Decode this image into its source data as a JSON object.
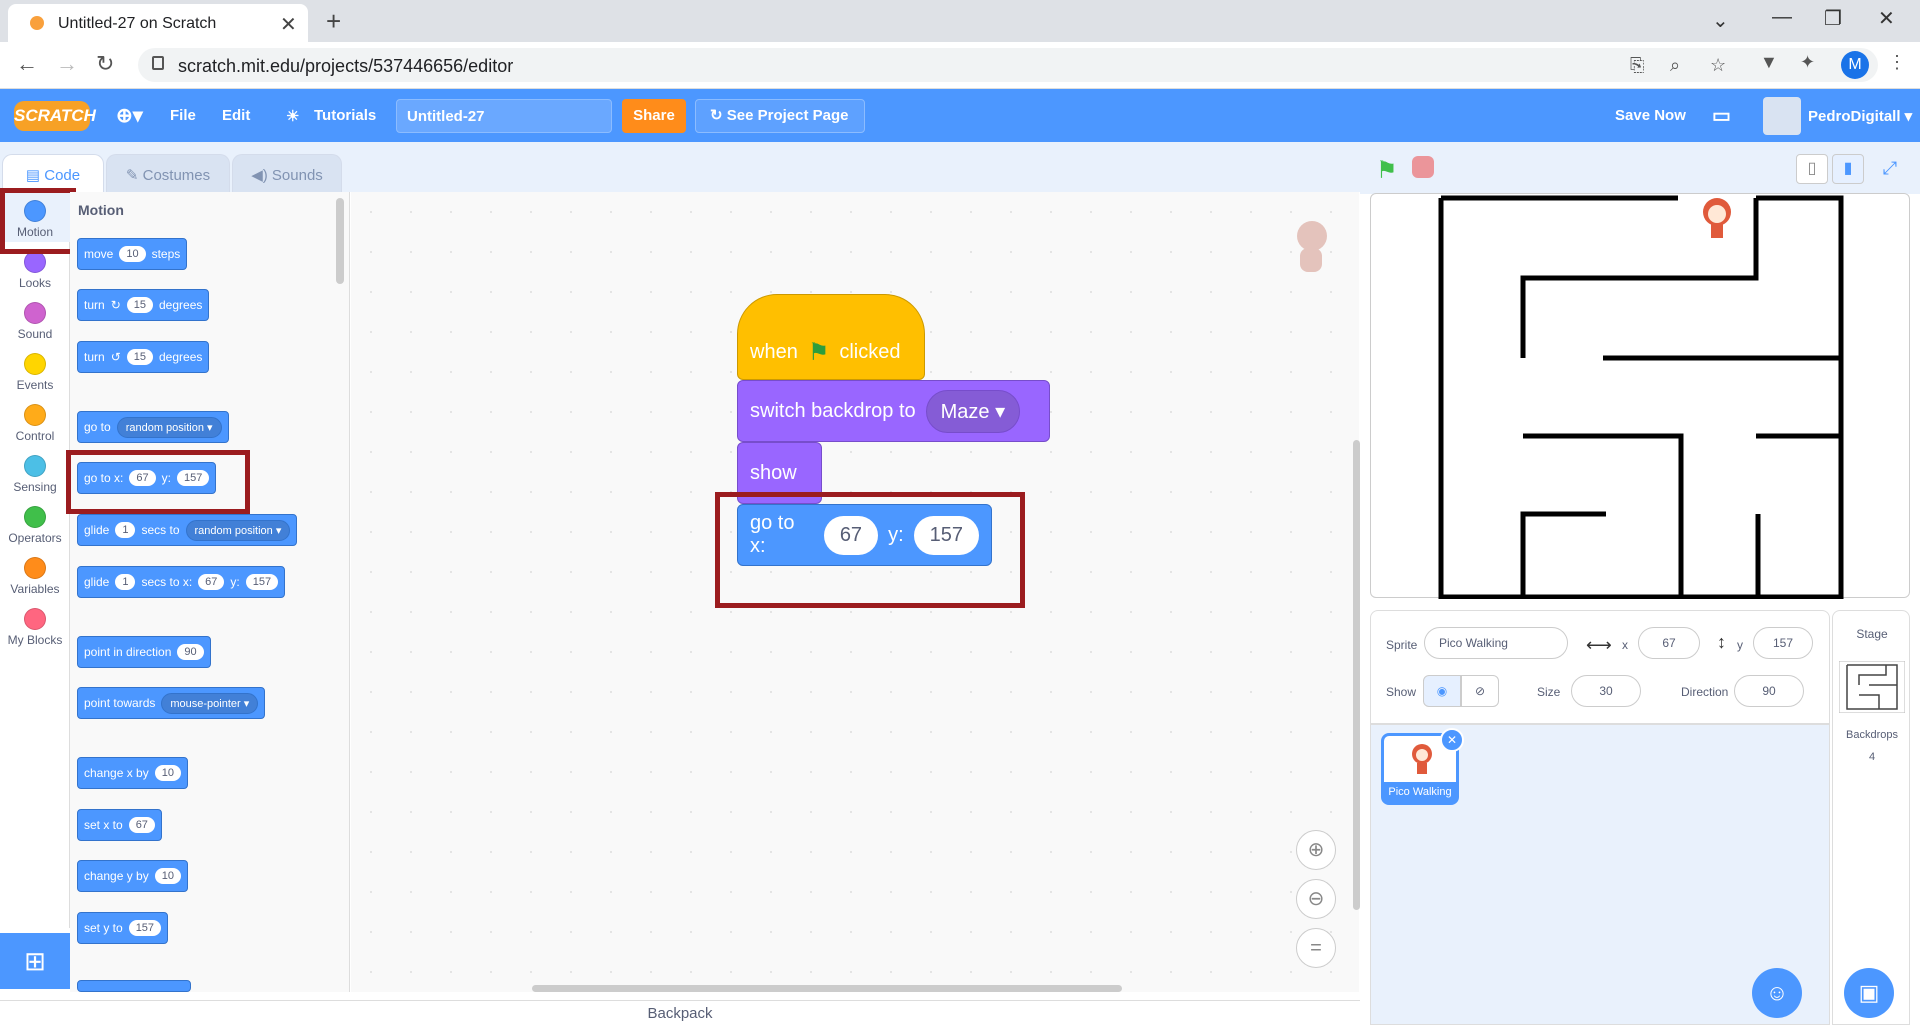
{
  "browser": {
    "tab_title": "Untitled-27 on Scratch",
    "url": "scratch.mit.edu/projects/537446656/editor",
    "profile_initial": "M"
  },
  "menu": {
    "logo": "SCRATCH",
    "file": "File",
    "edit": "Edit",
    "tutorials": "Tutorials",
    "project_name": "Untitled-27",
    "share": "Share",
    "see_project": "See Project Page",
    "save_now": "Save Now",
    "username": "PedroDigitall"
  },
  "tabs": {
    "code": "Code",
    "costumes": "Costumes",
    "sounds": "Sounds"
  },
  "categories": [
    {
      "label": "Motion",
      "color": "#4c97ff"
    },
    {
      "label": "Looks",
      "color": "#9966ff"
    },
    {
      "label": "Sound",
      "color": "#cf63cf"
    },
    {
      "label": "Events",
      "color": "#ffd500"
    },
    {
      "label": "Control",
      "color": "#ffab19"
    },
    {
      "label": "Sensing",
      "color": "#4cbfe6"
    },
    {
      "label": "Operators",
      "color": "#40bf4a"
    },
    {
      "label": "Variables",
      "color": "#ff8c1a"
    },
    {
      "label": "My Blocks",
      "color": "#ff6680"
    }
  ],
  "palette": {
    "title": "Motion",
    "move": {
      "a": "move",
      "v": "10",
      "b": "steps"
    },
    "turn_right": {
      "a": "turn",
      "v": "15",
      "b": "degrees"
    },
    "turn_left": {
      "a": "turn",
      "v": "15",
      "b": "degrees"
    },
    "goto": {
      "a": "go to",
      "d": "random position"
    },
    "gotoxy": {
      "a": "go to x:",
      "x": "67",
      "b": "y:",
      "y": "157"
    },
    "glide_to": {
      "a": "glide",
      "v": "1",
      "b": "secs to",
      "d": "random position"
    },
    "glide_xy": {
      "a": "glide",
      "v": "1",
      "b": "secs to x:",
      "x": "67",
      "c": "y:",
      "y": "157"
    },
    "point_dir": {
      "a": "point in direction",
      "v": "90"
    },
    "point_towards": {
      "a": "point towards",
      "d": "mouse-pointer"
    },
    "change_x": {
      "a": "change x by",
      "v": "10"
    },
    "set_x": {
      "a": "set x to",
      "v": "67"
    },
    "change_y": {
      "a": "change y by",
      "v": "10"
    },
    "set_y": {
      "a": "set y to",
      "v": "157"
    }
  },
  "script": {
    "hat_a": "when",
    "hat_b": "clicked",
    "backdrop_label": "switch backdrop to",
    "backdrop_value": "Maze",
    "show": "show",
    "goto_label": "go to x:",
    "goto_x": "67",
    "goto_ylabel": "y:",
    "goto_y": "157"
  },
  "backpack": "Backpack",
  "sprite_info": {
    "sprite_label": "Sprite",
    "sprite_name": "Pico Walking",
    "x_label": "x",
    "x": "67",
    "y_label": "y",
    "y": "157",
    "show_label": "Show",
    "size_label": "Size",
    "size": "30",
    "direction_label": "Direction",
    "direction": "90"
  },
  "sprite_card_name": "Pico Walking",
  "stage_pane": {
    "title": "Stage",
    "backdrops_label": "Backdrops",
    "backdrops_count": "4"
  },
  "colors": {
    "motion": "#4c97ff",
    "looks": "#9966ff",
    "events": "#ffbf00",
    "highlight": "#9b1c1f"
  }
}
